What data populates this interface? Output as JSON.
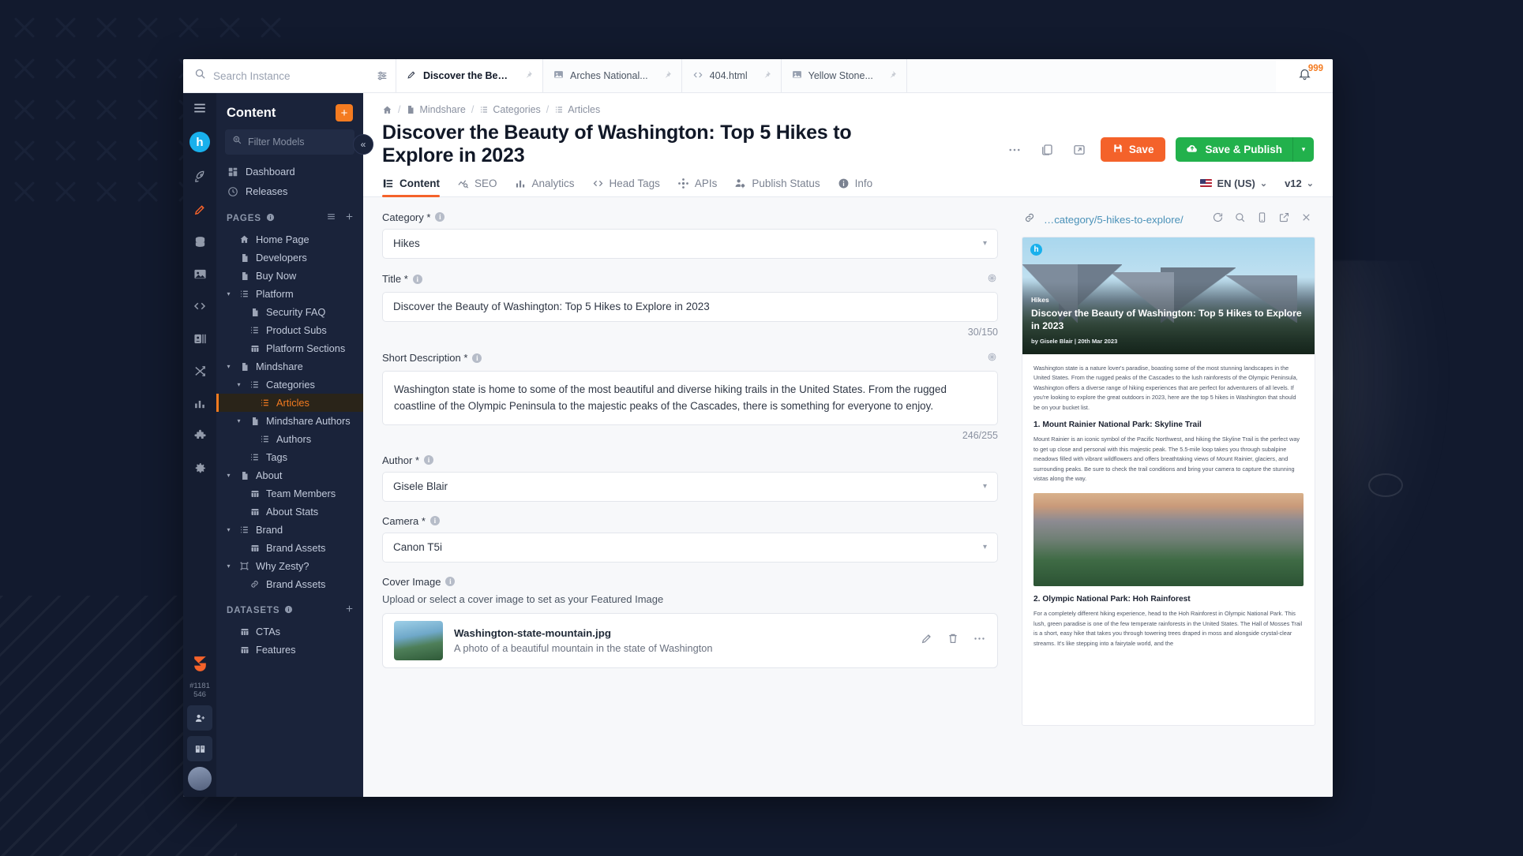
{
  "topbar": {
    "search_placeholder": "Search Instance",
    "search_value": "",
    "search_icon": "search-icon",
    "filter_icon": "sliders-icon",
    "bell_icon": "bell-icon",
    "notification_count": "999",
    "tabs": [
      {
        "label": "Discover the Beau...",
        "icon": "pencil-icon",
        "pin": "pin-icon",
        "active": true
      },
      {
        "label": "Arches National...",
        "icon": "image-icon",
        "pin": "pin-icon",
        "active": false
      },
      {
        "label": "404.html",
        "icon": "code-icon",
        "pin": "pin-icon",
        "active": false
      },
      {
        "label": "Yellow Stone...",
        "icon": "image-icon",
        "pin": "pin-icon",
        "active": false
      }
    ]
  },
  "rail": {
    "menu_icon": "hamburger-icon",
    "logo_text": "h",
    "icons": [
      {
        "name": "rocket-icon",
        "selected": false
      },
      {
        "name": "pencil-icon",
        "selected": true
      },
      {
        "name": "database-icon",
        "selected": false
      },
      {
        "name": "media-image-icon",
        "selected": false
      },
      {
        "name": "code-icon",
        "selected": false
      },
      {
        "name": "contacts-icon",
        "selected": false
      },
      {
        "name": "shuffle-icon",
        "selected": false
      },
      {
        "name": "analytics-bar-icon",
        "selected": false
      },
      {
        "name": "puzzle-icon",
        "selected": false
      },
      {
        "name": "gear-icon",
        "selected": false
      }
    ],
    "zesty_logo": "zesty-z-icon",
    "version_line1": "#1181",
    "version_line2": "546",
    "bottom_icons": [
      {
        "name": "add-user-icon"
      },
      {
        "name": "docs-book-icon"
      }
    ],
    "avatar": "user-avatar"
  },
  "sidebar": {
    "title": "Content",
    "add_button_label": "+",
    "add_button_name": "add-content-button",
    "filter_placeholder": "Filter Models",
    "filter_value": "",
    "filter_icon": "filter-models-icon",
    "links": [
      {
        "label": "Dashboard",
        "icon": "dashboard-icon"
      },
      {
        "label": "Releases",
        "icon": "clock-icon"
      }
    ],
    "sections": [
      {
        "label": "PAGES",
        "info_icon": "info-icon",
        "list_icon": "list-view-icon",
        "add_icon": "plus-icon",
        "items": [
          {
            "label": "Home Page",
            "icon": "home-icon",
            "indent": 0,
            "caret": "",
            "active": false
          },
          {
            "label": "Developers",
            "icon": "page-icon",
            "indent": 0,
            "caret": "",
            "active": false
          },
          {
            "label": "Buy Now",
            "icon": "page-icon",
            "indent": 0,
            "caret": "",
            "active": false
          },
          {
            "label": "Platform",
            "icon": "list-icon",
            "indent": 0,
            "caret": "▾",
            "active": false
          },
          {
            "label": "Security FAQ",
            "icon": "page-icon",
            "indent": 1,
            "caret": "",
            "active": false
          },
          {
            "label": "Product Subs",
            "icon": "list-icon",
            "indent": 1,
            "caret": "",
            "active": false
          },
          {
            "label": "Platform Sections",
            "icon": "grid-icon",
            "indent": 1,
            "caret": "",
            "active": false
          },
          {
            "label": "Mindshare",
            "icon": "page-icon",
            "indent": 0,
            "caret": "▾",
            "active": false
          },
          {
            "label": "Categories",
            "icon": "list-icon",
            "indent": 1,
            "caret": "▾",
            "active": false
          },
          {
            "label": "Articles",
            "icon": "list-icon",
            "indent": 2,
            "caret": "",
            "active": true
          },
          {
            "label": "Mindshare Authors",
            "icon": "page-icon",
            "indent": 1,
            "caret": "▾",
            "active": false
          },
          {
            "label": "Authors",
            "icon": "list-icon",
            "indent": 2,
            "caret": "",
            "active": false
          },
          {
            "label": "Tags",
            "icon": "list-icon",
            "indent": 1,
            "caret": "",
            "active": false
          },
          {
            "label": "About",
            "icon": "page-icon",
            "indent": 0,
            "caret": "▾",
            "active": false
          },
          {
            "label": "Team Members",
            "icon": "grid-icon",
            "indent": 1,
            "caret": "",
            "active": false
          },
          {
            "label": "About Stats",
            "icon": "grid-icon",
            "indent": 1,
            "caret": "",
            "active": false
          },
          {
            "label": "Brand",
            "icon": "list-icon",
            "indent": 0,
            "caret": "▾",
            "active": false
          },
          {
            "label": "Brand Assets",
            "icon": "grid-icon",
            "indent": 1,
            "caret": "",
            "active": false
          },
          {
            "label": "Why Zesty?",
            "icon": "frame-icon",
            "indent": 0,
            "caret": "▾",
            "active": false
          },
          {
            "label": "Brand Assets",
            "icon": "link-icon",
            "indent": 1,
            "caret": "",
            "active": false
          }
        ]
      },
      {
        "label": "DATASETS",
        "info_icon": "info-icon",
        "list_icon": "",
        "add_icon": "plus-icon",
        "items": [
          {
            "label": "CTAs",
            "icon": "grid-icon",
            "indent": 0,
            "caret": "",
            "active": false
          },
          {
            "label": "Features",
            "icon": "grid-icon",
            "indent": 0,
            "caret": "",
            "active": false
          }
        ]
      }
    ],
    "collapse_icon": "«"
  },
  "main": {
    "breadcrumb": [
      {
        "label": "",
        "icon": "home-icon"
      },
      {
        "label": "Mindshare",
        "icon": "page-icon"
      },
      {
        "label": "Categories",
        "icon": "list-icon"
      },
      {
        "label": "Articles",
        "icon": "list-icon"
      }
    ],
    "breadcrumb_separator": "/",
    "page_title": "Discover the Beauty of Washington: Top 5 Hikes to Explore in 2023",
    "actions": {
      "more_icon": "ellipsis-icon",
      "duplicate_icon": "duplicate-icon",
      "open-external_icon": "open-external-icon",
      "save_label": "Save",
      "save_icon": "floppy-disk-icon",
      "publish_label": "Save & Publish",
      "publish_icon": "cloud-upload-icon",
      "publish_caret": "▾"
    },
    "tabs": [
      {
        "label": "Content",
        "icon": "content-list-icon",
        "active": true
      },
      {
        "label": "SEO",
        "icon": "seo-chart-icon",
        "active": false
      },
      {
        "label": "Analytics",
        "icon": "analytics-bar-icon",
        "active": false
      },
      {
        "label": "Head Tags",
        "icon": "code-icon",
        "active": false
      },
      {
        "label": "APIs",
        "icon": "api-node-icon",
        "active": false
      },
      {
        "label": "Publish Status",
        "icon": "user-settings-icon",
        "active": false
      },
      {
        "label": "Info",
        "icon": "info-icon",
        "active": false
      }
    ],
    "locale": {
      "label": "EN (US)",
      "flag": "us-flag-icon",
      "caret": "⌄"
    },
    "version": {
      "label": "v12",
      "caret": "⌄"
    }
  },
  "form": {
    "fields": [
      {
        "type": "select",
        "label": "Category",
        "required": "*",
        "info_icon": "info-icon",
        "value": "Hikes",
        "caret": "▾",
        "name": "category-select"
      },
      {
        "type": "text",
        "label": "Title",
        "required": "*",
        "info_icon": "info-icon",
        "trailing_icon": "ai-sparkle-icon",
        "value": "Discover the Beauty of Washington: Top 5 Hikes to Explore in 2023",
        "counter": "30/150",
        "name": "title-input"
      },
      {
        "type": "textarea",
        "label": "Short Description",
        "required": "*",
        "info_icon": "info-icon",
        "trailing_icon": "ai-sparkle-icon",
        "value": "Washington state is home to some of the most beautiful and diverse hiking trails in the United States. From the rugged coastline of the Olympic Peninsula to the majestic peaks of the Cascades, there is something for everyone to enjoy.",
        "counter": "246/255",
        "name": "short-description-textarea"
      },
      {
        "type": "select",
        "label": "Author",
        "required": "*",
        "info_icon": "info-icon",
        "value": "Gisele Blair",
        "caret": "▾",
        "name": "author-select"
      },
      {
        "type": "select",
        "label": "Camera",
        "required": "*",
        "info_icon": "info-icon",
        "value": "Canon T5i",
        "caret": "▾",
        "name": "camera-select"
      }
    ],
    "cover": {
      "label": "Cover Image",
      "required": "",
      "info_icon": "info-icon",
      "help": "Upload or select a cover image to set as your Featured Image",
      "file_name": "Washington-state-mountain.jpg",
      "file_desc": "A photo of a beautiful mountain in the state of Washington",
      "edit_icon": "pencil-icon",
      "delete_icon": "trash-icon",
      "more_icon": "ellipsis-icon"
    }
  },
  "preview": {
    "link_icon": "link-icon",
    "url": "…category/5-hikes-to-explore/",
    "actions": [
      {
        "name": "refresh-icon"
      },
      {
        "name": "zoom-icon"
      },
      {
        "name": "mobile-icon"
      },
      {
        "name": "open-external-icon"
      },
      {
        "name": "close-icon"
      }
    ],
    "hero": {
      "logo": "h",
      "category": "Hikes",
      "title": "Discover the Beauty of Washington: Top 5 Hikes to Explore in 2023",
      "byline": "by Gisele Blair | 20th Mar 2023"
    },
    "intro": "Washington state is a nature lover's paradise, boasting some of the most stunning landscapes in the United States. From the rugged peaks of the Cascades to the lush rainforests of the Olympic Peninsula, Washington offers a diverse range of hiking experiences that are perfect for adventurers of all levels. If you're looking to explore the great outdoors in 2023, here are the top 5 hikes in Washington that should be on your bucket list.",
    "section1_heading": "1. Mount Rainier National Park: Skyline Trail",
    "section1_body": "Mount Rainier is an iconic symbol of the Pacific Northwest, and hiking the Skyline Trail is the perfect way to get up close and personal with this majestic peak. The 5.5-mile loop takes you through subalpine meadows filled with vibrant wildflowers and offers breathtaking views of Mount Rainier, glaciers, and surrounding peaks. Be sure to check the trail conditions and bring your camera to capture the stunning vistas along the way.",
    "section2_heading": "2. Olympic National Park: Hoh Rainforest",
    "section2_body": "For a completely different hiking experience, head to the Hoh Rainforest in Olympic National Park. This lush, green paradise is one of the few temperate rainforests in the United States. The Hall of Mosses Trail is a short, easy hike that takes you through towering trees draped in moss and alongside crystal-clear streams. It's like stepping into a fairytale world, and the"
  },
  "colors": {
    "accent_orange": "#f4622a",
    "publish_green": "#22b14c",
    "brand_blue": "#18b0ec",
    "sidebar_bg": "#1a233a",
    "rail_bg": "#151d31"
  }
}
